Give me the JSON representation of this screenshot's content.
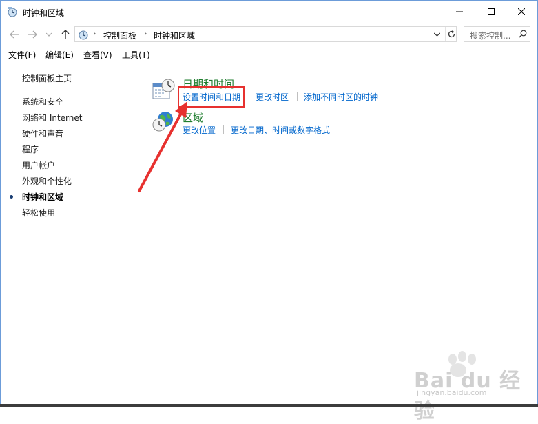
{
  "window": {
    "title": "时钟和区域"
  },
  "address": {
    "crumbs": [
      "控制面板",
      "时钟和区域"
    ],
    "search_placeholder": "搜索控制..."
  },
  "menu": [
    "文件(F)",
    "编辑(E)",
    "查看(V)",
    "工具(T)"
  ],
  "nav": {
    "home": "控制面板主页",
    "items": [
      "系统和安全",
      "网络和 Internet",
      "硬件和声音",
      "程序",
      "用户帐户",
      "外观和个性化",
      "时钟和区域",
      "轻松使用"
    ],
    "active_index": 6
  },
  "categories": [
    {
      "title": "日期和时间",
      "icon": "calendar-clock-icon",
      "links": [
        "设置时间和日期",
        "更改时区",
        "添加不同时区的时钟"
      ]
    },
    {
      "title": "区域",
      "icon": "globe-clock-icon",
      "links": [
        "更改位置",
        "更改日期、时间或数字格式"
      ]
    }
  ],
  "watermark": {
    "brand": "Bai du 经验",
    "url": "jingyan.baidu.com"
  },
  "colors": {
    "link": "#0066cc",
    "category_title": "#1e7d2e",
    "highlight": "#e7312f",
    "border": "#6c9cd9"
  }
}
